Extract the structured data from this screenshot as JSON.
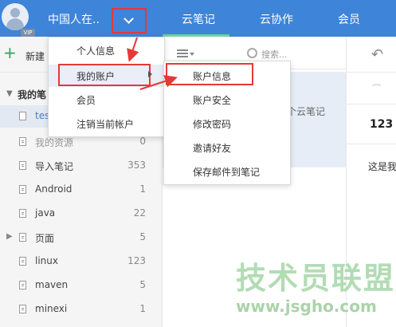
{
  "header": {
    "username": "中国人在..",
    "vip_badge": "VIP",
    "tabs": [
      {
        "label": "云笔记"
      },
      {
        "label": "云协作"
      },
      {
        "label": "会员"
      }
    ]
  },
  "sidebar": {
    "new_label": "新建",
    "my_notes": "我的笔",
    "selected_item": "tes",
    "items": [
      {
        "label": "我的资源",
        "count": "0"
      },
      {
        "label": "导入笔记",
        "count": "353"
      },
      {
        "label": "Android",
        "count": "1"
      },
      {
        "label": "java",
        "count": "22"
      },
      {
        "label": "页面",
        "count": "5"
      },
      {
        "label": "linux",
        "count": "123"
      },
      {
        "label": "maven",
        "count": "5"
      },
      {
        "label": "minexi",
        "count": "1"
      }
    ]
  },
  "list": {
    "search_placeholder": "搜索...",
    "hint": "个云笔记"
  },
  "detail": {
    "number": "123",
    "text": "这是我"
  },
  "account_menu": {
    "items": [
      {
        "label": "个人信息"
      },
      {
        "label": "我的账户"
      },
      {
        "label": "会员"
      },
      {
        "label": "注销当前帐户"
      }
    ]
  },
  "account_submenu": {
    "items": [
      {
        "label": "账户信息"
      },
      {
        "label": "账户安全"
      },
      {
        "label": "修改密码"
      },
      {
        "label": "邀请好友"
      },
      {
        "label": "保存邮件到笔记"
      }
    ]
  },
  "watermark": {
    "line1": "技术员联盟",
    "line2": "www.jsgho.com"
  },
  "colors": {
    "topbar": "#3e84d9",
    "active_tab_underline": "#6dd19a",
    "annotation_red": "#e53935"
  }
}
